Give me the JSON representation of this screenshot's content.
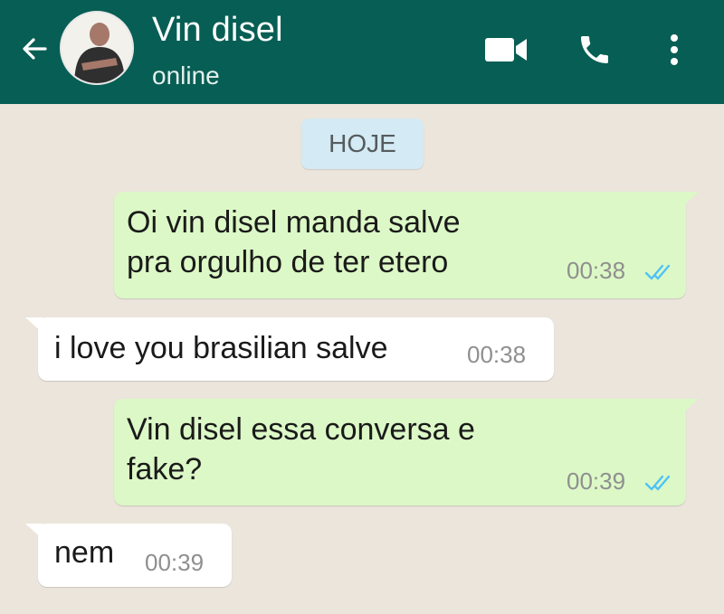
{
  "header": {
    "contact_name": "Vin disel",
    "status": "online",
    "icons": [
      "back-arrow-icon",
      "video-call-icon",
      "voice-call-icon",
      "more-options-icon"
    ]
  },
  "chat": {
    "date_label": "HOJE",
    "messages": [
      {
        "direction": "out",
        "text": "Oi vin disel manda salve\npra orgulho de ter etero",
        "time": "00:38",
        "status": "read"
      },
      {
        "direction": "in",
        "text": "i love you brasilian salve",
        "time": "00:38"
      },
      {
        "direction": "out",
        "text": "Vin disel essa conversa e\nfake?",
        "time": "00:39",
        "status": "read"
      },
      {
        "direction": "in",
        "text": "nem",
        "time": "00:39"
      }
    ]
  },
  "colors": {
    "header_bg": "#075e54",
    "outgoing_bubble": "#dcf8c6",
    "incoming_bubble": "#ffffff",
    "read_tick": "#4fc3f7",
    "chat_bg": "#ebe5dc"
  }
}
